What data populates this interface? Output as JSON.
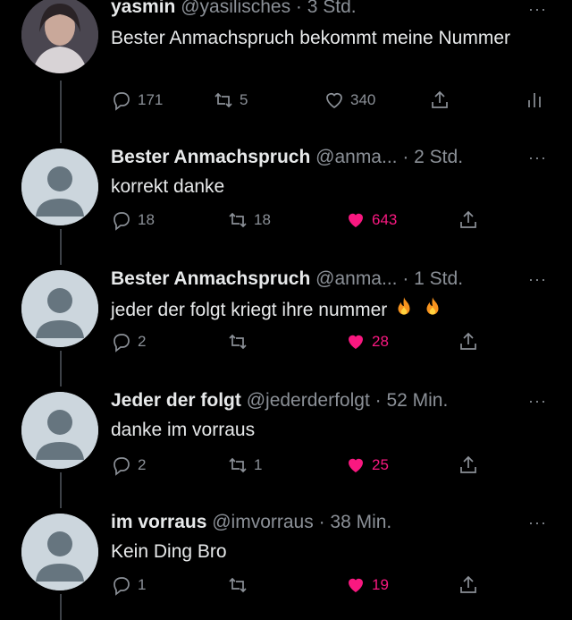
{
  "tweets": [
    {
      "name": "yasmin",
      "meta": "@yasilisches · 3 Std.",
      "text": "Bester Anmachspruch bekommt meine Nummer",
      "replies": "171",
      "retweets": "5",
      "likes": "340",
      "liked": false,
      "avatar": "photo"
    },
    {
      "name": "Bester Anmachspruch",
      "meta": "@anma... · 2 Std.",
      "text": "korrekt danke",
      "replies": "18",
      "retweets": "18",
      "likes": "643",
      "liked": true,
      "avatar": "default"
    },
    {
      "name": "Bester Anmachspruch",
      "meta": "@anma... · 1 Std.",
      "text": "jeder der folgt kriegt ihre nummer",
      "emoji": "fire-fire",
      "replies": "2",
      "retweets": "",
      "likes": "28",
      "liked": true,
      "avatar": "default"
    },
    {
      "name": "Jeder der folgt",
      "meta": "@jederderfolgt · 52 Min.",
      "text": "danke im vorraus",
      "replies": "2",
      "retweets": "1",
      "likes": "25",
      "liked": true,
      "avatar": "default"
    },
    {
      "name": "im vorraus",
      "meta": "@imvorraus · 38 Min.",
      "text": "Kein Ding Bro",
      "replies": "1",
      "retweets": "",
      "likes": "19",
      "liked": true,
      "avatar": "default"
    }
  ],
  "more_label": "···",
  "colors": {
    "like": "#f91880",
    "muted": "#8b9097",
    "text": "#e7e9ea",
    "background": "#000000"
  }
}
